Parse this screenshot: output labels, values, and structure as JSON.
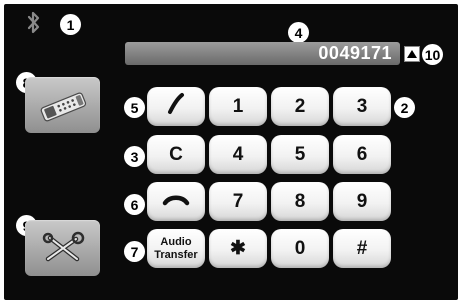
{
  "display": {
    "number": "0049171"
  },
  "callouts": [
    "1",
    "2",
    "3",
    "4",
    "5",
    "6",
    "7",
    "8",
    "9",
    "10"
  ],
  "keys": {
    "k1": "1",
    "k2": "2",
    "k3": "3",
    "clear": "C",
    "k4": "4",
    "k5": "5",
    "k6": "6",
    "k7": "7",
    "k8": "8",
    "k9": "9",
    "audio_transfer": "Audio\nTransfer",
    "star": "✱",
    "k0": "0",
    "hash": "#"
  },
  "icons": {
    "bluetooth": "bluetooth-icon",
    "phonebook": "phonebook-icon",
    "settings": "settings-icon",
    "call": "call-icon",
    "hang_up": "hang-up-icon",
    "scroll_up": "scroll-up-arrow-icon"
  },
  "colors": {
    "screen_bg": "#0a0a0a",
    "key_bg": "#ffffff",
    "side_button": "#a8a8a8",
    "display_bar": "#858585"
  }
}
